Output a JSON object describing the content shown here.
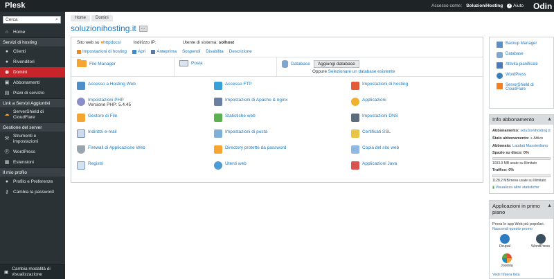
{
  "app": {
    "name": "Plesk",
    "brand_right": "Odin"
  },
  "topbar": {
    "access_label": "Accesso come:",
    "user": "SoluzioniHosting",
    "help_label": "Aiuto"
  },
  "sidebar": {
    "search_placeholder": "Cerca",
    "home": "Home",
    "sections": [
      {
        "title": "Servizi di hosting",
        "items": [
          "Clienti",
          "Rivenditori",
          "Domini",
          "Abbonamenti",
          "Piani di servizio"
        ]
      },
      {
        "title": "Link a Servizi Aggiuntivi",
        "items": [
          "ServerShield di CloudFlare"
        ]
      },
      {
        "title": "Gestione del server",
        "items": [
          "Strumenti e impostazioni",
          "WordPress",
          "Estensioni"
        ]
      },
      {
        "title": "Il mio profilo",
        "items": [
          "Profilo e Preferenze",
          "Cambia la password"
        ]
      }
    ],
    "bottom": "Cambia modalità di visualizzazione"
  },
  "breadcrumb": [
    "Home",
    "Domini"
  ],
  "page": {
    "title": "soluzionihosting.it",
    "more": "...",
    "website_label": "Sito web su",
    "website_path": "httpdocs/",
    "ip_label": "Indirizzo IP:",
    "sysuser_label": "Utente di sistema:",
    "sysuser": "solhost",
    "actions": [
      "Impostazioni di hosting",
      "Apri",
      "Anteprima",
      "Sospendi",
      "Disabilita",
      "Descrizione"
    ]
  },
  "top_cells": {
    "file_manager": "File Manager",
    "mail": "Posta",
    "database": "Database",
    "add_db_button": "Aggiungi database",
    "or_label": "Oppure",
    "select_db_link": "Selezionare un database esistente"
  },
  "grid": [
    {
      "label": "Accesso a Hosting Web"
    },
    {
      "label": "Accesso FTP"
    },
    {
      "label": "Impostazioni di hosting"
    },
    {
      "label": "Impostazioni PHP",
      "sub": "Versione PHP: 5.4.45"
    },
    {
      "label": "Impostazioni di Apache & nginx"
    },
    {
      "label": "Applicazioni"
    },
    {
      "label": "Gestore di File"
    },
    {
      "label": "Statistiche web"
    },
    {
      "label": "Impostazioni DNS"
    },
    {
      "label": "Indirizzi e-mail"
    },
    {
      "label": "Impostazioni di posta"
    },
    {
      "label": "Certificati SSL"
    },
    {
      "label": "Firewall di Applicazione Web"
    },
    {
      "label": "Directory protette da password"
    },
    {
      "label": "Copia del sito web"
    },
    {
      "label": "Registri"
    },
    {
      "label": "Utenti web"
    },
    {
      "label": "Applicazioni Java"
    }
  ],
  "right": {
    "links": [
      "Backup Manager",
      "Database",
      "Attività pianificate",
      "WordPress",
      "ServerShield di CloudFlare"
    ],
    "sub_info": {
      "title": "Info abbonamento",
      "subscription_label": "Abbonamento:",
      "subscription": "soluzionihosting.it",
      "status_label": "Stato abbonamento:",
      "status": "Attivo",
      "subscriber_label": "Abbonato:",
      "subscriber": "Laudati Massimiliano",
      "disk_label": "Spazio su disco: 0%",
      "disk_detail": "1033.9 MB usate su Illimitato",
      "traffic_label": "Traffico: 0%",
      "traffic_detail": "1128.2 MB/mese usate su Illimitato",
      "stats_link": "Visualizza altre statistiche",
      "disk_percent": 0,
      "traffic_percent": 0
    },
    "apps": {
      "title": "Applicazioni in primo piano",
      "subtitle": "Prova le app Web più popolari.",
      "hide_link": "Nascondi questo promo",
      "items": [
        "Drupal",
        "WordPress",
        "Joomla"
      ],
      "all_link": "Vedi l'intera lista"
    }
  },
  "colors": {
    "accent": "#1b78c2",
    "active": "#c8252b",
    "topbar": "#1e2326",
    "sidebar": "#2b3236"
  }
}
